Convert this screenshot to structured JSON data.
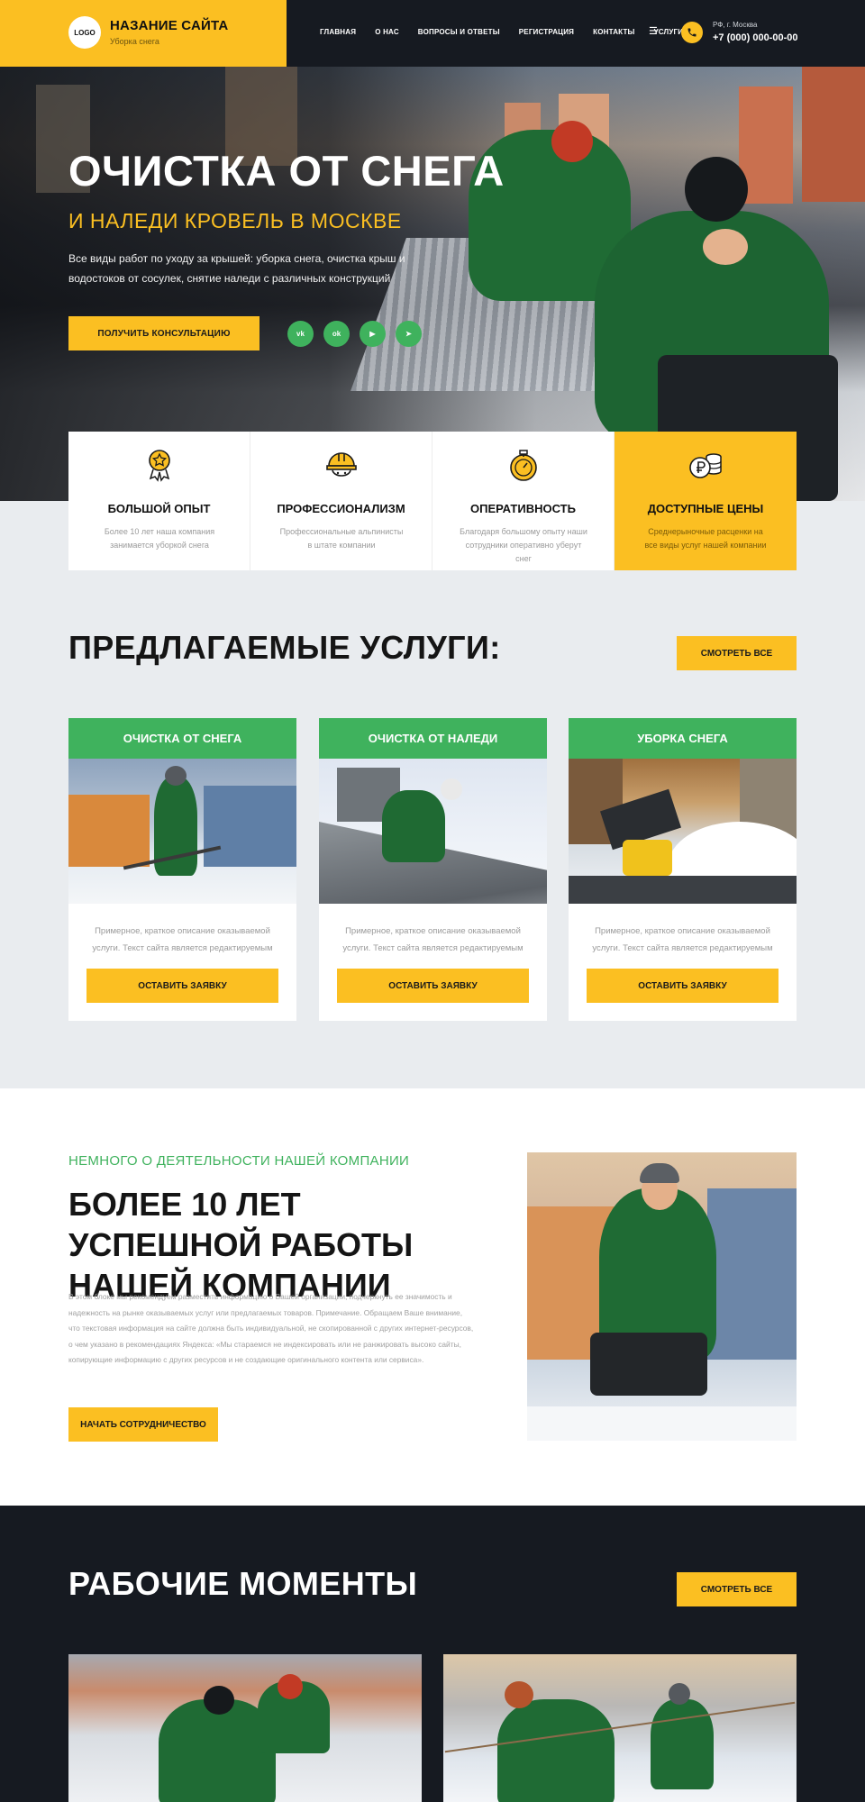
{
  "header": {
    "logo": "LOGO",
    "site_name": "НАЗАНИЕ САЙТА",
    "site_tagline": "Уборка снега",
    "nav": [
      "ГЛАВНАЯ",
      "О НАС",
      "ВОПРОСЫ И ОТВЕТЫ",
      "РЕГИСТРАЦИЯ",
      "КОНТАКТЫ",
      "УСЛУГИ"
    ],
    "menu_icon": "menu-icon",
    "phone_city": "РФ, г. Москва",
    "phone": "+7 (000) 000-00-00"
  },
  "hero": {
    "title": "ОЧИСТКА ОТ СНЕГА",
    "subtitle": "И НАЛЕДИ КРОВЕЛЬ В МОСКВЕ",
    "description": "Все виды работ по уходу за крышей: уборка снега, очистка крыш и водостоков от сосулек, снятие наледи с различных конструкций",
    "cta": "ПОЛУЧИТЬ КОНСУЛЬТАЦИЮ",
    "socials": [
      {
        "icon": "vk-icon",
        "label": "vk"
      },
      {
        "icon": "odnoklassniki-icon",
        "label": "ok"
      },
      {
        "icon": "youtube-icon",
        "label": "▶"
      },
      {
        "icon": "telegram-icon",
        "label": "➤"
      }
    ]
  },
  "features": [
    {
      "icon": "award-icon",
      "title": "БОЛЬШОЙ ОПЫТ",
      "text": "Более 10 лет наша компания занимается уборкой снега"
    },
    {
      "icon": "helmet-icon",
      "title": "ПРОФЕССИОНАЛИЗМ",
      "text": "Профессиональные альпинисты в штате компании"
    },
    {
      "icon": "stopwatch-icon",
      "title": "ОПЕРАТИВНОСТЬ",
      "text": "Благодаря большому опыту наши сотрудники оперативно уберут снег"
    },
    {
      "icon": "ruble-coins-icon",
      "title": "ДОСТУПНЫЕ ЦЕНЫ",
      "text": "Среднерыночные расценки на все виды услуг нашей компании"
    }
  ],
  "services": {
    "title": "ПРЕДЛАГАЕМЫЕ УСЛУГИ:",
    "see_all": "СМОТРЕТЬ ВСЕ",
    "cards": [
      {
        "title": "ОЧИСТКА ОТ СНЕГА",
        "text": "Примерное, краткое описание оказываемой услуги. Текст сайта является редактируемым",
        "button": "ОСТАВИТЬ ЗАЯВКУ"
      },
      {
        "title": "ОЧИСТКА ОТ НАЛЕДИ",
        "text": "Примерное, краткое описание оказываемой услуги. Текст сайта является редактируемым",
        "button": "ОСТАВИТЬ ЗАЯВКУ"
      },
      {
        "title": "УБОРКА СНЕГА",
        "text": "Примерное, краткое описание оказываемой услуги. Текст сайта является редактируемым",
        "button": "ОСТАВИТЬ ЗАЯВКУ"
      }
    ]
  },
  "about": {
    "kicker": "НЕМНОГО О ДЕЯТЕЛЬНОСТИ НАШЕЙ КОМПАНИИ",
    "title": "БОЛЕЕ 10 ЛЕТ УСПЕШНОЙ РАБОТЫ НАШЕЙ КОМПАНИИ",
    "text": "В этом блоке мы рекомендуем разместить информацию о Вашей организации, подчеркнуть ее значимость и надежность на рынке оказываемых услуг или предлагаемых товаров. Примечание. Обращаем Ваше внимание, что текстовая информация на сайте должна быть индивидуальной, не скопированной с других интернет-ресурсов, о чем указано в рекомендациях Яндекса: «Мы стараемся не индексировать или не ранжировать высоко сайты, копирующие информацию с других ресурсов и не создающие оригинального контента или сервиса».",
    "button": "НАЧАТЬ СОТРУДНИЧЕСТВО"
  },
  "works": {
    "title": "РАБОЧИЕ МОМЕНТЫ",
    "see_all": "СМОТРЕТЬ ВСЕ"
  },
  "colors": {
    "accent_yellow": "#fbbf22",
    "accent_green": "#3fb25d",
    "dark": "#161a21"
  }
}
